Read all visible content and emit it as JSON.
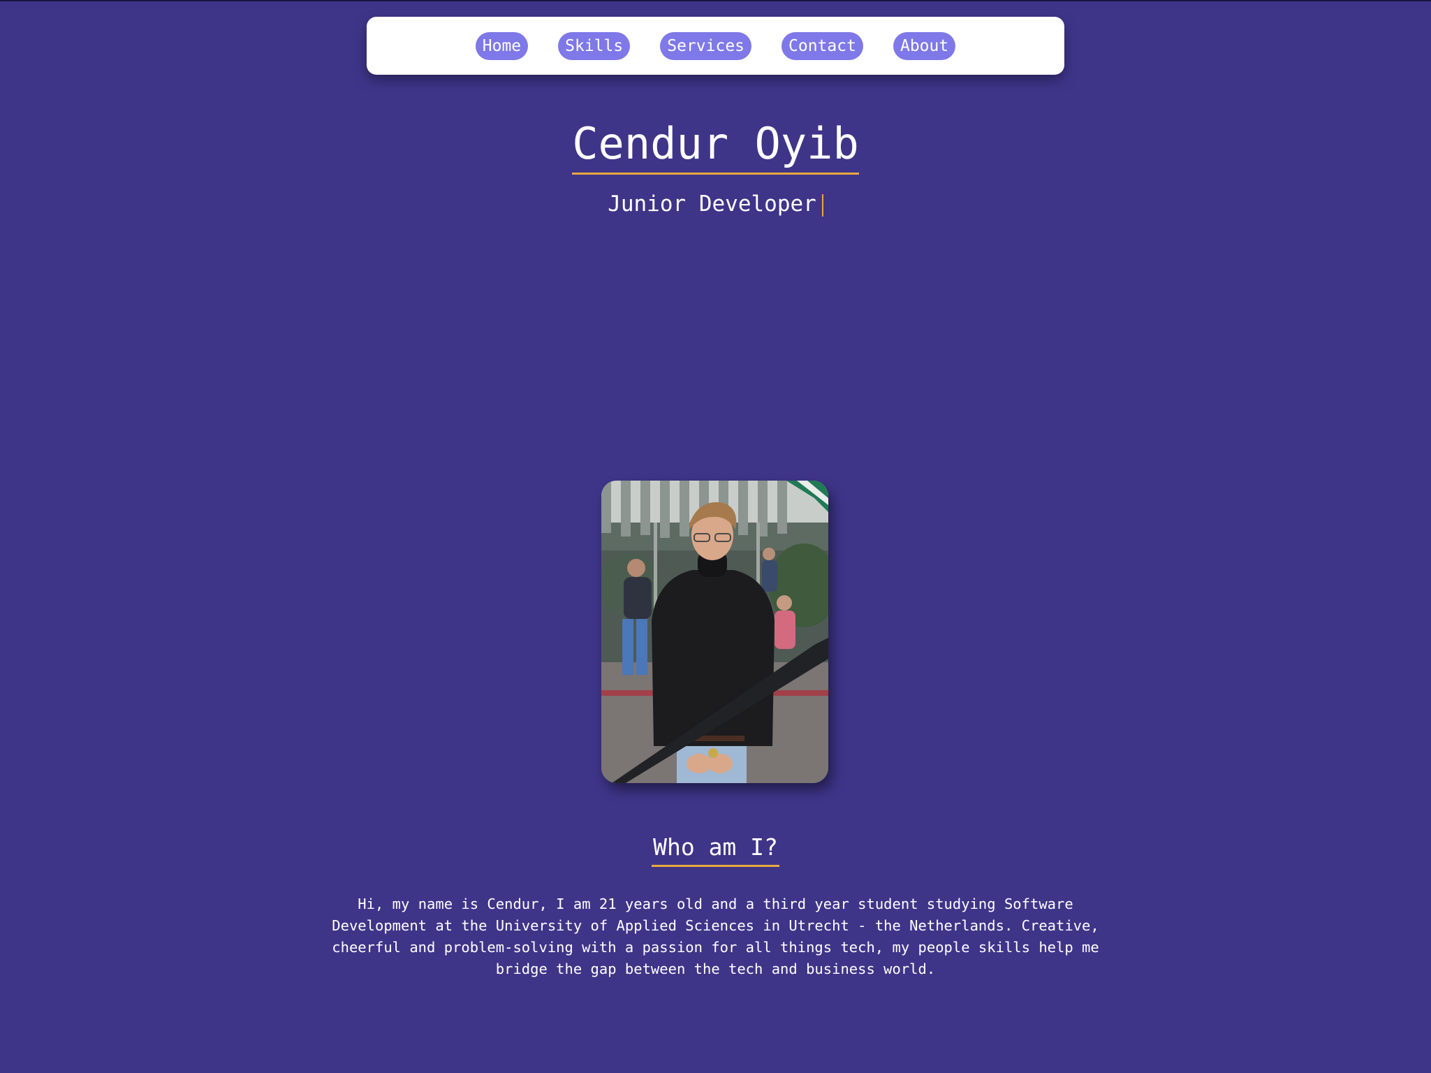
{
  "nav": {
    "items": [
      {
        "label": "Home"
      },
      {
        "label": "Skills"
      },
      {
        "label": "Services"
      },
      {
        "label": "Contact"
      },
      {
        "label": "About"
      }
    ]
  },
  "hero": {
    "name": "Cendur Oyib",
    "role": "Junior Developer"
  },
  "about": {
    "heading": "Who am I?",
    "text": "Hi, my name is Cendur, I am 21 years old and a third year student studying Software Development at the University of Applied Sciences in Utrecht - the Netherlands. Creative, cheerful and problem-solving with a passion for all things tech, my people skills help me bridge the gap between the tech and business world."
  },
  "colors": {
    "background": "#3e3589",
    "nav_button": "#7e78e8",
    "accent_underline": "#e8a93a"
  }
}
